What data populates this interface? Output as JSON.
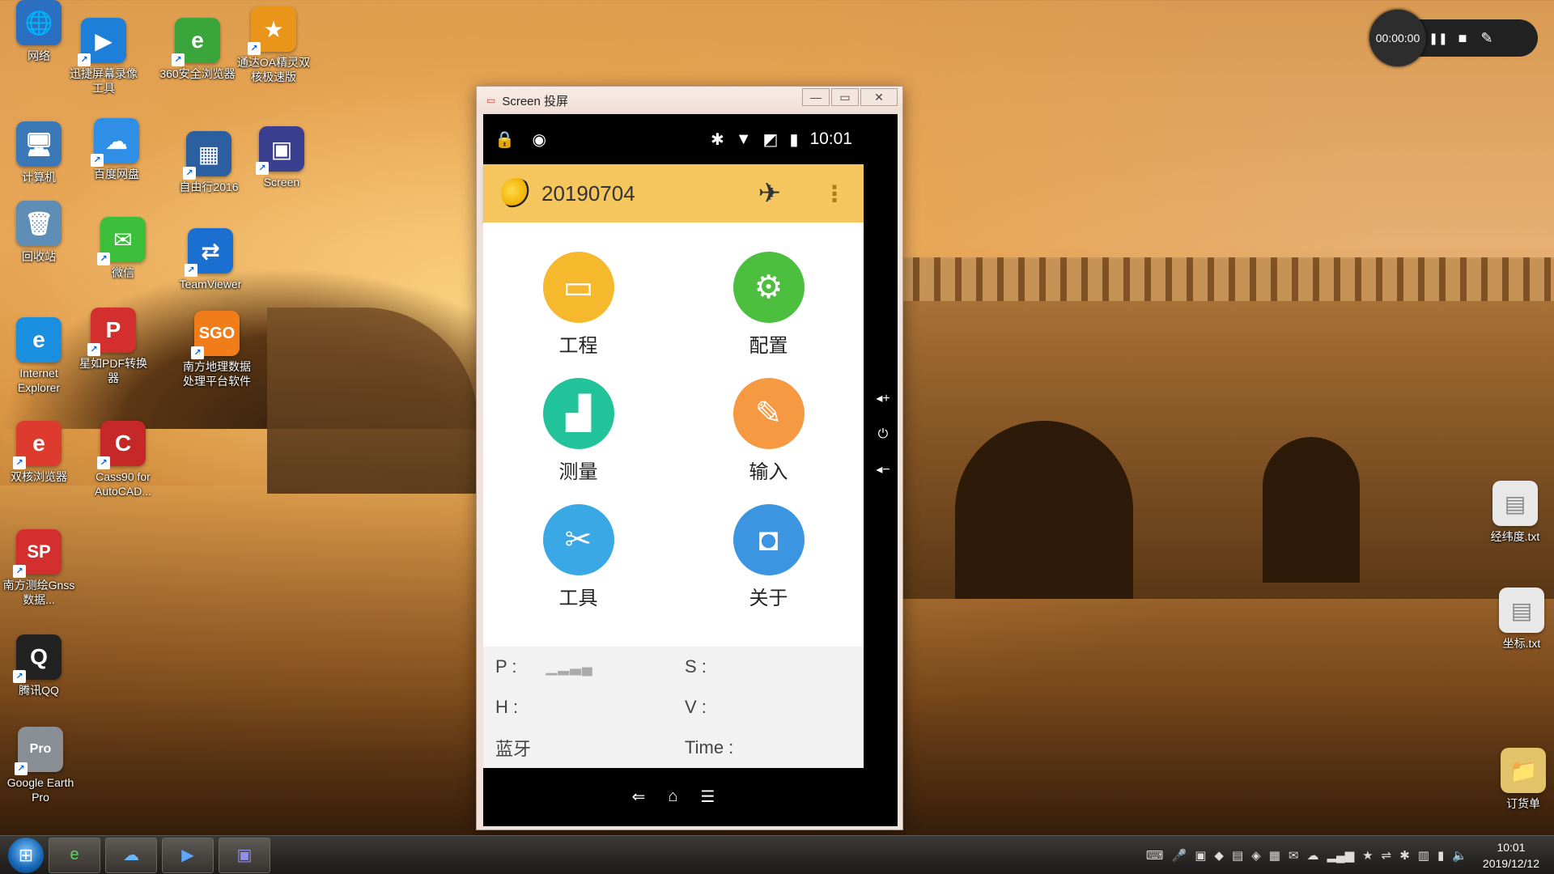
{
  "desktop_icons": [
    {
      "label": "网络",
      "glyph": "🌐",
      "color": "#2a6fc0"
    },
    {
      "label": "迅捷屏幕录像工具",
      "glyph": "▶",
      "color": "#1e7fd8"
    },
    {
      "label": "360安全浏览器",
      "glyph": "e",
      "color": "#3aa53a"
    },
    {
      "label": "通达OA精灵双核极速版",
      "glyph": "★",
      "color": "#e8951a"
    },
    {
      "label": "计算机",
      "glyph": "🖥",
      "color": "#3b78b8"
    },
    {
      "label": "百度网盘",
      "glyph": "☁",
      "color": "#2f8fe6"
    },
    {
      "label": "自由行2016",
      "glyph": "▦",
      "color": "#2b5fa0"
    },
    {
      "label": "Screen",
      "glyph": "▣",
      "color": "#3a3f8f"
    },
    {
      "label": "回收站",
      "glyph": "🗑",
      "color": "#5e8db5"
    },
    {
      "label": "微信",
      "glyph": "✉",
      "color": "#3bbf3b"
    },
    {
      "label": "TeamViewer",
      "glyph": "⇄",
      "color": "#1b6fd1"
    },
    {
      "label": "Internet Explorer",
      "glyph": "e",
      "color": "#1a8fe0"
    },
    {
      "label": "星如PDF转换器",
      "glyph": "P",
      "color": "#d32f2f"
    },
    {
      "label": "南方地理数据处理平台软件",
      "glyph": "SGO",
      "color": "#f07d1a"
    },
    {
      "label": "双核浏览器",
      "glyph": "e",
      "color": "#dd3b2e"
    },
    {
      "label": "Cass90 for AutoCAD...",
      "glyph": "C",
      "color": "#c62828"
    },
    {
      "label": "南方测绘Gnss数据...",
      "glyph": "SP",
      "color": "#d32f2f"
    },
    {
      "label": "腾讯QQ",
      "glyph": "Q",
      "color": "#222222"
    },
    {
      "label": "Google Earth Pro",
      "glyph": "Pro",
      "color": "#8a8f96"
    },
    {
      "label": "经纬度.txt",
      "glyph": "▤",
      "color": "#e8e8e8"
    },
    {
      "label": "坐标.txt",
      "glyph": "▤",
      "color": "#e8e8e8"
    },
    {
      "label": "订货单",
      "glyph": "📁",
      "color": "#e2c36a"
    }
  ],
  "recorder": {
    "time": "00:00:00",
    "pause": "❚❚",
    "stop": "■",
    "edit": "✎",
    "badge": "☁"
  },
  "window": {
    "title": "Screen 投屏",
    "app_icon": "▭",
    "minimize": "—",
    "maximize": "▭",
    "close": "✕"
  },
  "phone": {
    "status": {
      "lock": "🔒",
      "android": "◉",
      "bluetooth": "✱",
      "wifi": "▼",
      "sim": "◩",
      "battery": "▮",
      "time": "10:01"
    },
    "appbar": {
      "title": "20190704",
      "satellite": "✈",
      "more": "⋮"
    },
    "tiles": [
      {
        "label": "工程",
        "glyph": "▭",
        "color": "#f6b82c"
      },
      {
        "label": "配置",
        "glyph": "⚙",
        "color": "#4cbf3f"
      },
      {
        "label": "测量",
        "glyph": "▟",
        "color": "#22c29a"
      },
      {
        "label": "输入",
        "glyph": "✎",
        "color": "#f59a43"
      },
      {
        "label": "工具",
        "glyph": "✂",
        "color": "#3aa8e4"
      },
      {
        "label": "关于",
        "glyph": "◘",
        "color": "#3b95e0"
      }
    ],
    "info": {
      "p_label": "P :",
      "signal": "▁▂▃▄",
      "s_label": "S :",
      "h_label": "H :",
      "v_label": "V :",
      "bt_label": "蓝牙",
      "time_label": "Time :"
    },
    "nav": {
      "back": "⇐",
      "home": "⌂",
      "menu": "☰"
    },
    "side": {
      "vol_up": "◂+",
      "power": "⏻",
      "vol_down": "◂−"
    }
  },
  "taskbar": {
    "start": "⊞",
    "apps": [
      {
        "glyph": "e",
        "name": "360-browser"
      },
      {
        "glyph": "☁",
        "name": "baidu-netdisk"
      },
      {
        "glyph": "▶",
        "name": "screen-recorder"
      },
      {
        "glyph": "▣",
        "name": "screen-cast"
      }
    ],
    "tray": [
      "⌨",
      "🎤",
      "▣",
      "◆",
      "▤",
      "◈",
      "▦",
      "✉",
      "☁",
      "▂▄▆",
      "★",
      "⇌",
      "✱",
      "▥",
      "▮",
      "🔈"
    ],
    "time": "10:01",
    "date": "2019/12/12"
  }
}
